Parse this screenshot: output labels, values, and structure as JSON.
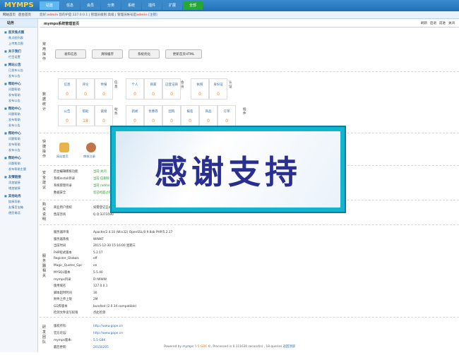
{
  "logo": "MYMPS",
  "nav": [
    "站首",
    "信息",
    "会员",
    "分类",
    "系统",
    "插件",
    "扩展",
    "全部"
  ],
  "sub": {
    "links": [
      "网站首页",
      "后台首页"
    ],
    "welcome_prefix": "您好:",
    "user": "admin",
    "welcome_rest": "您的IP是:127.0.0.1 | 管理员级别:高级 | 管理员帐号是",
    "role": "admin",
    "logout": "[注销]"
  },
  "side": {
    "head": "站务",
    "groups": [
      {
        "title": "首页焦点图",
        "items": [
          "焦点图列表",
          "上传焦点图"
        ]
      },
      {
        "title": "关于我们",
        "items": [
          "栏目设置"
        ]
      },
      {
        "title": "网站公告",
        "items": [
          "已发布公告",
          "发布公告"
        ]
      },
      {
        "title": "帮助中心",
        "items": [
          "问题帮助",
          "发布帮助",
          "发布公告"
        ]
      },
      {
        "title": "帮助中心",
        "items": [
          "问题帮助",
          "发布帮助",
          "发布公告"
        ]
      },
      {
        "title": "帮助中心",
        "items": [
          "问题帮助",
          "发布帮助",
          "发布公告"
        ]
      },
      {
        "title": "帮助中心",
        "items": [
          "问题帮助",
          "发布帮助主题"
        ]
      },
      {
        "title": "友情链接",
        "items": [
          "添加链接",
          "增加链接"
        ]
      },
      {
        "title": "其他站务",
        "items": [
          "链接导航",
          "友情百宝箱",
          "便民电话"
        ]
      }
    ]
  },
  "main": {
    "title": "mymps系统管理首页",
    "title_right": [
      "刷新",
      "后退",
      "前进",
      "关闭"
    ],
    "s1_label": "常用操作",
    "buttons": [
      "发布信息",
      "清除缓存",
      "系统优化",
      "更新首页HTML"
    ],
    "s2_label": "数据统计",
    "stats_row1": {
      "headers": [
        "信息",
        "评论",
        "举报",
        "个人",
        "商家",
        "已登记商",
        "执照",
        "身份证"
      ],
      "values": [
        "0",
        "0",
        "0",
        "0",
        "0",
        "0",
        "0",
        "0"
      ],
      "sidelabels": [
        "信息",
        "会员",
        "认证"
      ]
    },
    "stats_row2": {
      "headers": [
        "公告",
        "帮助",
        "链接",
        "新闻",
        "优惠券",
        "团购",
        "报名",
        "商品",
        "订单"
      ],
      "values": [
        "0",
        "18",
        "0",
        "0",
        "0",
        "0",
        "0",
        "0",
        "0"
      ],
      "sidelabels": [
        "站务",
        "插件"
      ]
    },
    "s3_label": "快捷操作",
    "shortcuts": [
      "网站首页",
      "审核注册"
    ],
    "s4_label": "安全建议",
    "security": [
      [
        "后台编辑模板功能",
        "当前:关闭"
      ],
      [
        "系统install目录",
        "当前:已删除"
      ],
      [
        "系统管理目录",
        "当前:/admin"
      ],
      [
        "数据安全",
        "您已经超过有"
      ]
    ],
    "s5_label": "购买说明",
    "purchase": [
      [
        "商业用户授权",
        "如需登记正式"
      ],
      [
        "售前咨询",
        "Q Q:3373590"
      ]
    ],
    "s6_label": "服务器相关",
    "server": [
      [
        "服务器环境",
        "Apache/2.4.10 (Win32) OpenSSL/0.9.8zb PHP/5.2.17"
      ],
      [
        "服务器系统",
        "WINNT"
      ],
      [
        "当前时间",
        "2015-12-30 15:16:00 星期三"
      ],
      [
        "PHP程式版本",
        "5.2.17"
      ],
      [
        "Register_Globals",
        "off"
      ],
      [
        "Magic_Quotes_Gpc",
        "on"
      ],
      [
        "MYSQL版本",
        "5.5.40"
      ],
      [
        "mymps目录",
        "D:/WWW"
      ],
      [
        "使用域名",
        "127.0.0.1"
      ],
      [
        "脚本超时时间",
        "30"
      ],
      [
        "附件上传上限",
        "2M"
      ],
      [
        "GD库版本",
        "bundled (2.0.34 compatible)"
      ],
      [
        "检测文件读写权限",
        "点此检测"
      ]
    ],
    "s7_label": "研发团队",
    "team": [
      [
        "版权所有:",
        "http://www.gope.cn"
      ],
      [
        "官方论坛:",
        "http://www.gope.cn"
      ],
      [
        "mymps版本:",
        "5.5 GBK"
      ],
      [
        "最后更新:",
        "20150205"
      ]
    ]
  },
  "overlay_text": "感谢支持",
  "footer": {
    "pre": "Powered by",
    "brand": "mymps",
    "ver": "5.5 GBK",
    "post": "©, Processed in 0.111630 second(s) , 18 queries",
    "link": "返回顶部"
  }
}
